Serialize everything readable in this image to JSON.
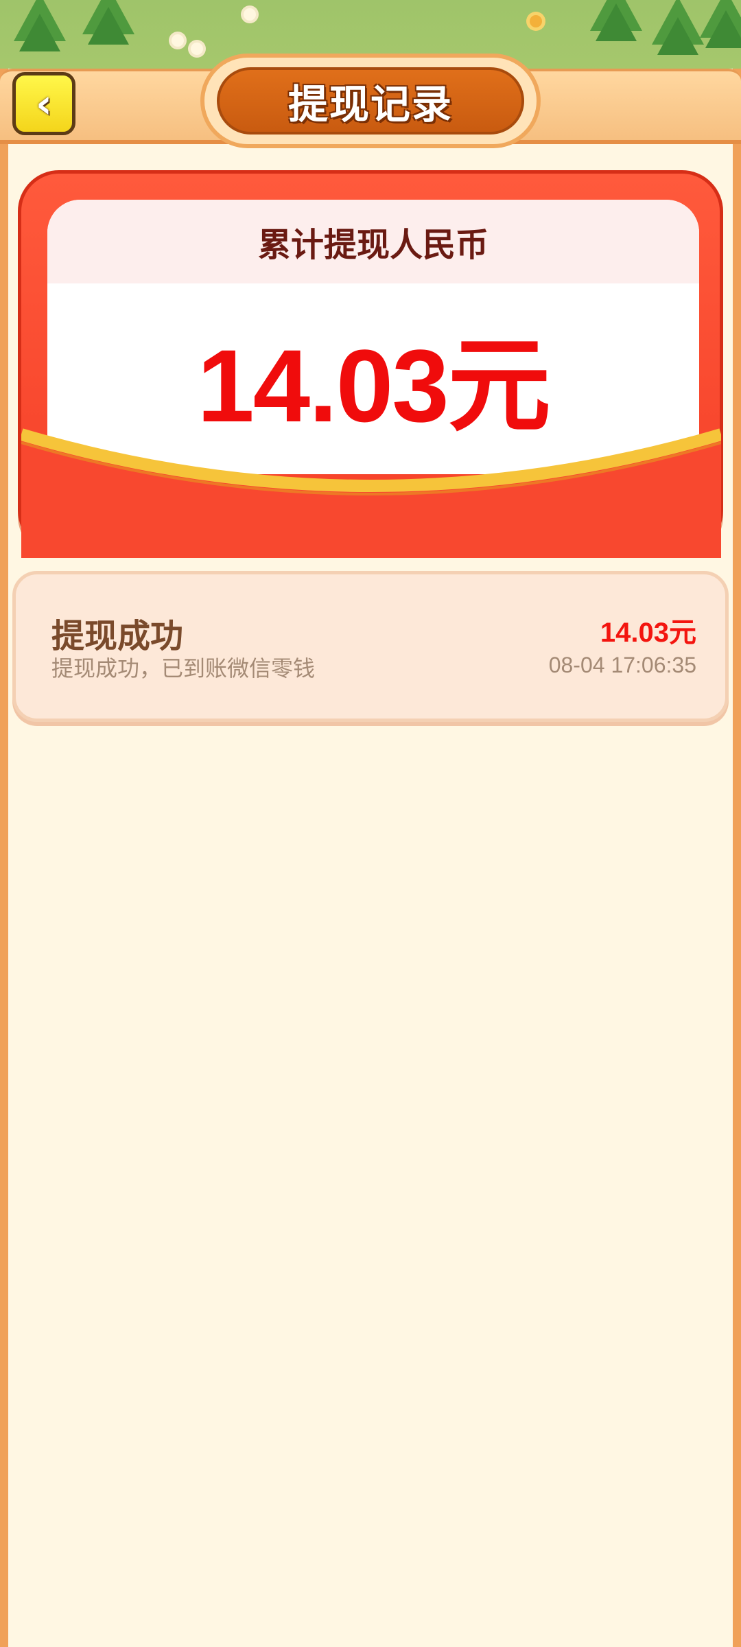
{
  "header": {
    "title": "提现记录",
    "back_icon": "chevron-left-icon",
    "back_glyph": "‹"
  },
  "summary": {
    "label": "累计提现人民币",
    "amount": "14.03元"
  },
  "records": [
    {
      "title": "提现成功",
      "subtitle": "提现成功，已到账微信零钱",
      "amount": "14.03元",
      "time": "08-04  17:06:35"
    }
  ],
  "colors": {
    "accent_red": "#f00c0c",
    "card_red": "#ff5a3c",
    "frame_orange": "#f0a159",
    "title_orange": "#e06f1a",
    "back_yellow": "#fff74a"
  }
}
